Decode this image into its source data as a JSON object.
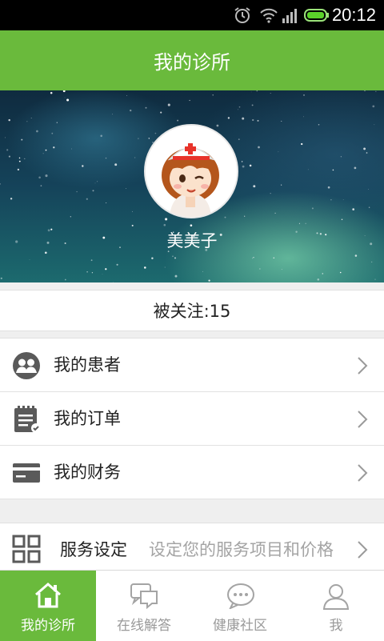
{
  "status_bar": {
    "time": "20:12"
  },
  "header": {
    "title": "我的诊所"
  },
  "profile": {
    "name": "美美子",
    "followers_label": "被关注:15"
  },
  "menu": [
    {
      "label": "我的患者",
      "icon": "patients-icon"
    },
    {
      "label": "我的订单",
      "icon": "orders-icon"
    },
    {
      "label": "我的财务",
      "icon": "finance-icon"
    }
  ],
  "service": {
    "label": "服务设定",
    "description": "设定您的服务项目和价格"
  },
  "tabs": [
    {
      "label": "我的诊所",
      "icon": "home-icon",
      "active": true
    },
    {
      "label": "在线解答",
      "icon": "chat-bubbles-icon",
      "active": false
    },
    {
      "label": "健康社区",
      "icon": "community-icon",
      "active": false
    },
    {
      "label": "我",
      "icon": "user-icon",
      "active": false
    }
  ],
  "colors": {
    "accent": "#6aba3c",
    "icon_gray": "#555555"
  }
}
